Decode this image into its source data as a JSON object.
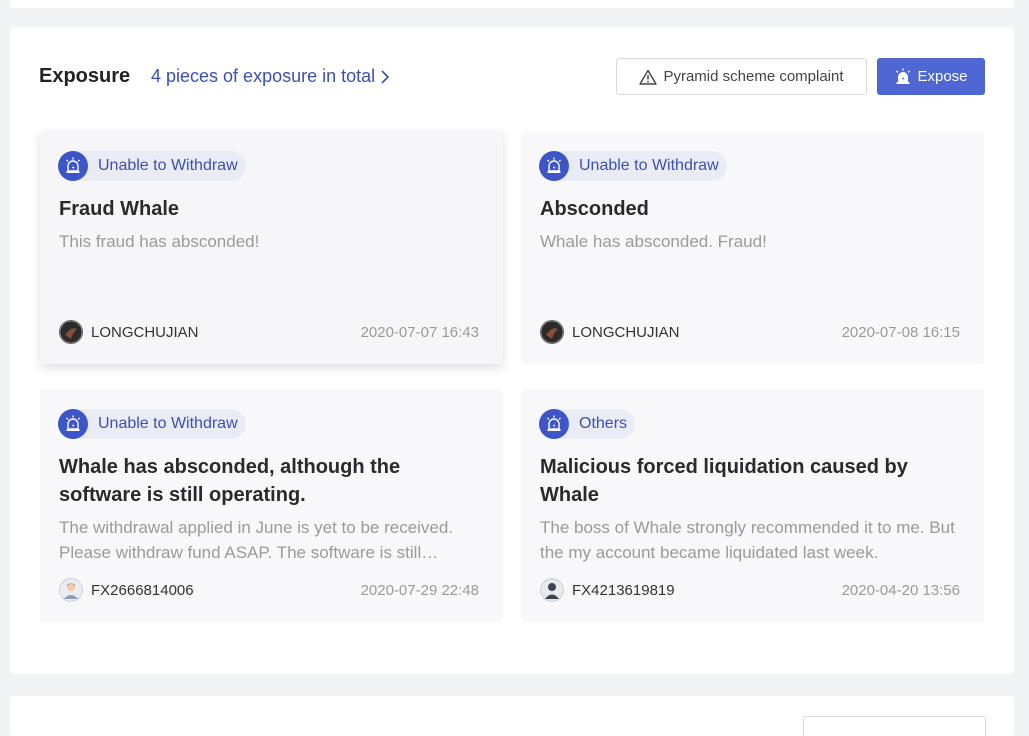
{
  "header": {
    "title": "Exposure",
    "total_link": "4 pieces of exposure in total",
    "complaint_button": "Pyramid scheme complaint",
    "expose_button": "Expose"
  },
  "colors": {
    "accent": "#4e67d2",
    "link": "#3b4fb4",
    "tag_bg": "#eaecf5"
  },
  "cards": [
    {
      "tag": "Unable to Withdraw",
      "title": "Fraud Whale",
      "description": "This fraud has absconded!",
      "author": "LONGCHUJIAN",
      "avatar_icon": "dark-avatar-icon",
      "timestamp": "2020-07-07 16:43"
    },
    {
      "tag": "Unable to Withdraw",
      "title": "Absconded",
      "description": "Whale has absconded. Fraud!",
      "author": "LONGCHUJIAN",
      "avatar_icon": "dark-avatar-icon",
      "timestamp": "2020-07-08 16:15"
    },
    {
      "tag": "Unable to Withdraw",
      "title": "Whale has absconded, although the software is still operating.",
      "description": "The withdrawal applied in June is yet to be received. Please withdraw fund ASAP. The software is still operating.",
      "author": "FX2666814006",
      "avatar_icon": "default-user-avatar-icon",
      "timestamp": "2020-07-29 22:48"
    },
    {
      "tag": "Others",
      "title": "Malicious forced liquidation caused by Whale",
      "description": "The boss of Whale strongly recommended it to me. But the my account became liquidated last week.",
      "author": "FX4213619819",
      "avatar_icon": "user-silhouette-avatar-icon",
      "timestamp": "2020-04-20 13:56"
    }
  ]
}
